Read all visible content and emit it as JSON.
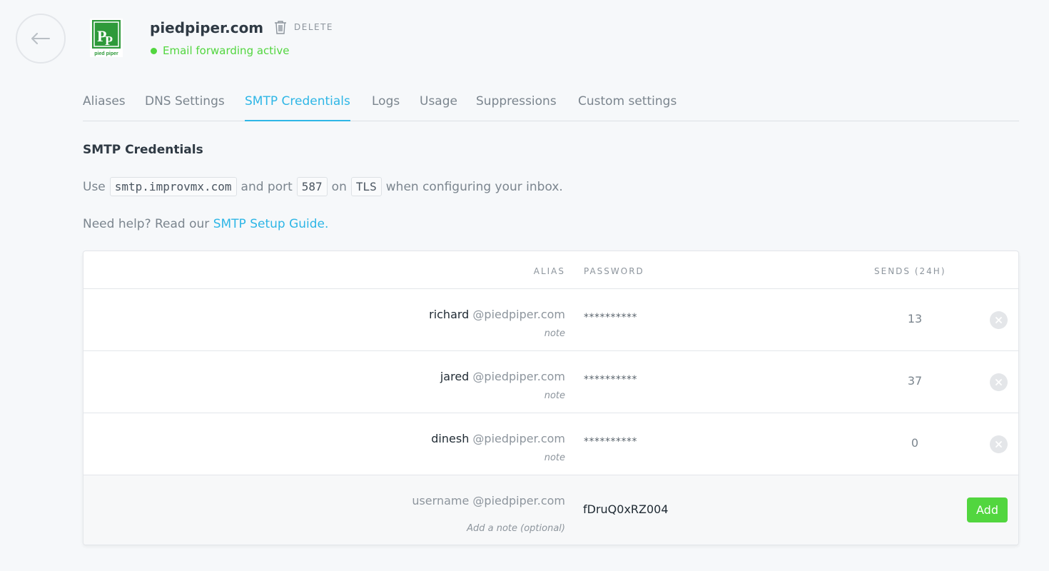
{
  "header": {
    "domain": "piedpiper.com",
    "delete_label": "DELETE",
    "status_text": "Email forwarding active",
    "status_color": "#52d63f",
    "logo_letters": "PP",
    "logo_caption": "pied piper"
  },
  "tabs": [
    {
      "label": "Aliases"
    },
    {
      "label": "DNS Settings"
    },
    {
      "label": "SMTP Credentials",
      "active": true
    },
    {
      "label": "Logs"
    },
    {
      "label": "Usage"
    },
    {
      "label": "Suppressions"
    },
    {
      "label": "Custom settings"
    }
  ],
  "section": {
    "title": "SMTP Credentials",
    "use_prefix": "Use",
    "host": "smtp.improvmx.com",
    "and_port": "and port",
    "port": "587",
    "on": "on",
    "protocol": "TLS",
    "suffix": "when configuring your inbox.",
    "help_prefix": "Need help? Read our",
    "help_link": "SMTP Setup Guide."
  },
  "table": {
    "columns": [
      "ALIAS",
      "PASSWORD",
      "SENDS (24H)"
    ],
    "rows": [
      {
        "user": "richard",
        "domain": "@piedpiper.com",
        "note": "note",
        "password": "**********",
        "sends": "13"
      },
      {
        "user": "jared",
        "domain": "@piedpiper.com",
        "note": "note",
        "password": "**********",
        "sends": "37"
      },
      {
        "user": "dinesh",
        "domain": "@piedpiper.com",
        "note": "note",
        "password": "**********",
        "sends": "0"
      }
    ],
    "new_row": {
      "username_placeholder": "username",
      "domain": "@piedpiper.com",
      "password_value": "fDruQ0xRZ004",
      "note_placeholder": "Add a note (optional)",
      "add_label": "Add"
    }
  },
  "colors": {
    "accent": "#2eb6e6",
    "success": "#52d63f"
  }
}
